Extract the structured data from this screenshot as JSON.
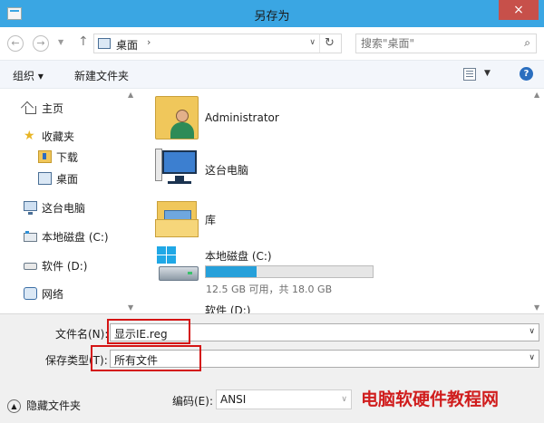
{
  "window": {
    "title": "另存为",
    "close_glyph": "×"
  },
  "navbar": {
    "back_glyph": "←",
    "forward_glyph": "→",
    "recent_glyph": "▼",
    "up_glyph": "↑",
    "location": "桌面",
    "location_sep": "›",
    "dropdown_glyph": "∨",
    "refresh_glyph": "↻",
    "search_placeholder": "搜索\"桌面\"",
    "search_icon": "search-icon"
  },
  "toolbar": {
    "organize": "组织 ▾",
    "new_folder": "新建文件夹",
    "view_dropdown": "▼",
    "help": "?"
  },
  "sidebar": {
    "items": [
      {
        "label": "主页",
        "icon": "home-icon"
      },
      {
        "label": "收藏夹",
        "icon": "star-icon"
      },
      {
        "label": "下载",
        "icon": "download-folder-icon"
      },
      {
        "label": "桌面",
        "icon": "desktop-icon"
      },
      {
        "label": "这台电脑",
        "icon": "computer-icon"
      },
      {
        "label": "本地磁盘 (C:)",
        "icon": "drive-icon"
      },
      {
        "label": "软件 (D:)",
        "icon": "dvd-drive-icon"
      },
      {
        "label": "网络",
        "icon": "network-icon"
      }
    ],
    "scroll_up": "▲",
    "scroll_down": "▼"
  },
  "content": {
    "items": [
      {
        "name": "Administrator",
        "icon": "user-folder-icon"
      },
      {
        "name": "这台电脑",
        "icon": "computer-icon"
      },
      {
        "name": "库",
        "icon": "library-icon"
      },
      {
        "name": "本地磁盘 (C:)",
        "icon": "windows-drive-icon"
      },
      {
        "name": "软件 (D:)",
        "icon": "dvd-drive-icon"
      }
    ],
    "drive_c": {
      "free_text": "12.5 GB 可用，共 18.0 GB",
      "free_gb": 12.5,
      "total_gb": 18.0
    },
    "scroll_up": "▲",
    "scroll_down": "▼"
  },
  "form": {
    "filename_label": "文件名(N):",
    "filename_value": "显示IE.reg",
    "type_label": "保存类型(T):",
    "type_value": "所有文件",
    "dropdown_glyph": "∨",
    "hide_folders": "隐藏文件夹",
    "hide_glyph": "▲",
    "encoding_label": "编码(E):",
    "encoding_value": "ANSI",
    "encoding_dropdown": "∨"
  },
  "watermark": "电脑软硬件教程网",
  "colors": {
    "titlebar": "#3aa6e3",
    "close_button": "#c7504a",
    "highlight_box": "#d41414",
    "usage_bar": "#26a0da",
    "watermark": "#d01d1d"
  }
}
